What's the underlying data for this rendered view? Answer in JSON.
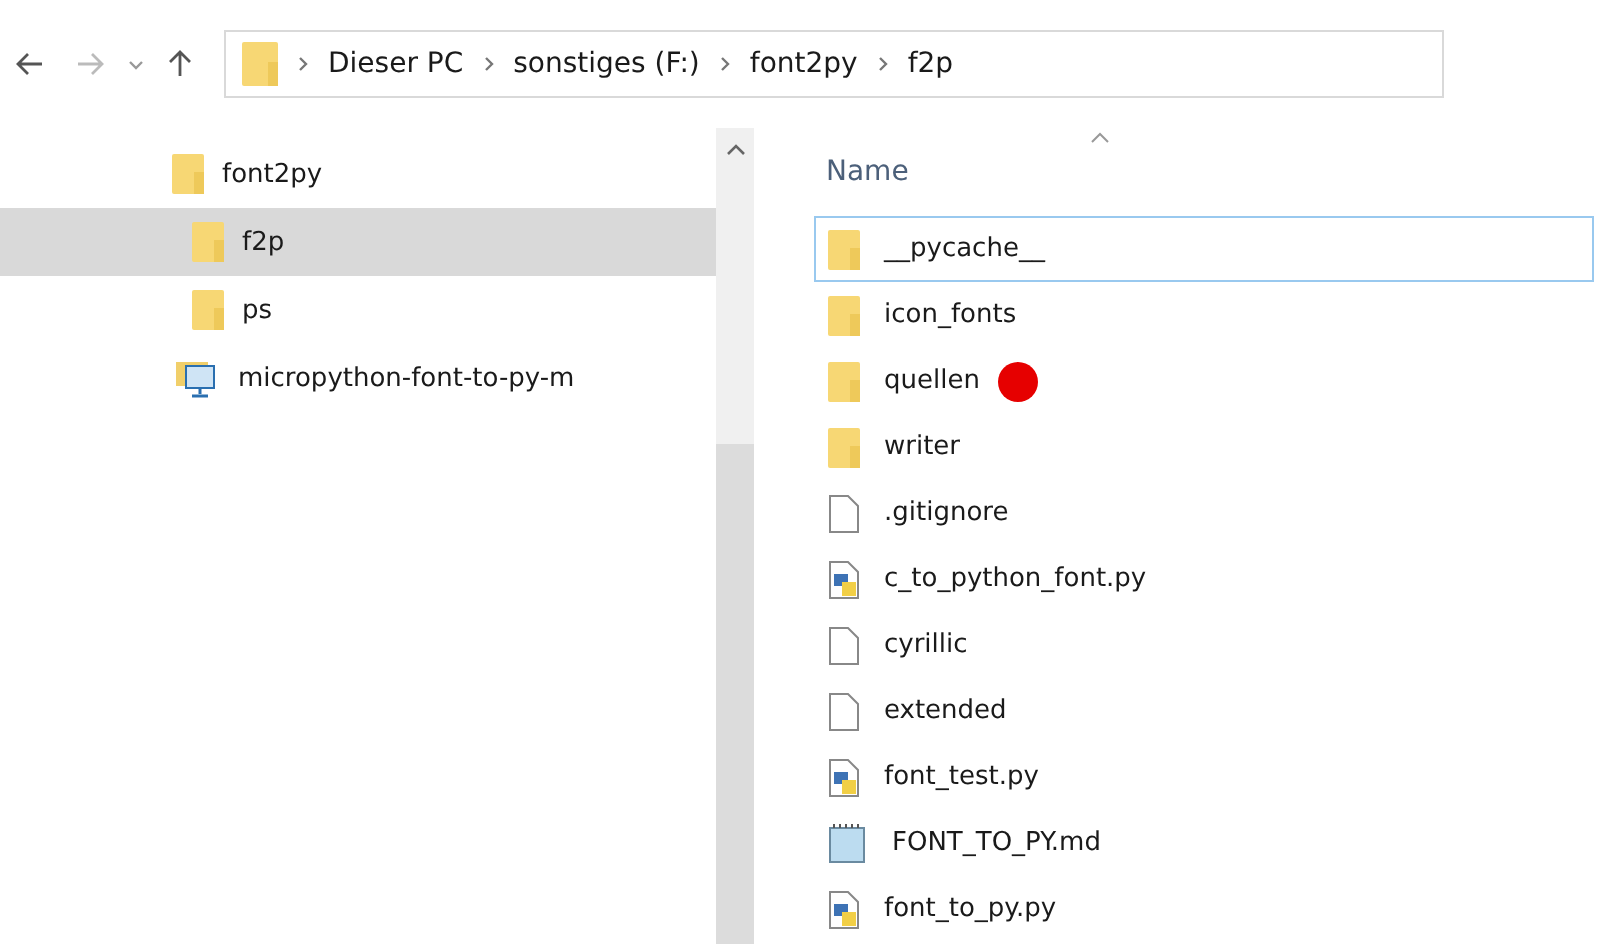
{
  "address_bar": {
    "path": [
      "Dieser PC",
      "sonstiges (F:)",
      "font2py",
      "f2p"
    ]
  },
  "nav_tree": [
    {
      "label": "font2py",
      "kind": "folder",
      "selected": false,
      "children": [
        {
          "label": "f2p",
          "kind": "folder",
          "selected": true
        },
        {
          "label": "ps",
          "kind": "folder",
          "selected": false
        },
        {
          "label": "micropython-font-to-py-m",
          "kind": "computer",
          "selected": false
        }
      ]
    }
  ],
  "file_list": {
    "column": "Name",
    "items": [
      {
        "name": "__pycache__",
        "kind": "folder",
        "focused": true,
        "marked": false
      },
      {
        "name": "icon_fonts",
        "kind": "folder",
        "focused": false,
        "marked": false
      },
      {
        "name": "quellen",
        "kind": "folder",
        "focused": false,
        "marked": true
      },
      {
        "name": "writer",
        "kind": "folder",
        "focused": false,
        "marked": false
      },
      {
        "name": ".gitignore",
        "kind": "file",
        "focused": false,
        "marked": false
      },
      {
        "name": "c_to_python_font.py",
        "kind": "python",
        "focused": false,
        "marked": false
      },
      {
        "name": "cyrillic",
        "kind": "file",
        "focused": false,
        "marked": false
      },
      {
        "name": "extended",
        "kind": "file",
        "focused": false,
        "marked": false
      },
      {
        "name": "font_test.py",
        "kind": "python",
        "focused": false,
        "marked": false
      },
      {
        "name": "FONT_TO_PY.md",
        "kind": "notepad",
        "focused": false,
        "marked": false
      },
      {
        "name": "font_to_py.py",
        "kind": "python",
        "focused": false,
        "marked": false
      }
    ]
  }
}
